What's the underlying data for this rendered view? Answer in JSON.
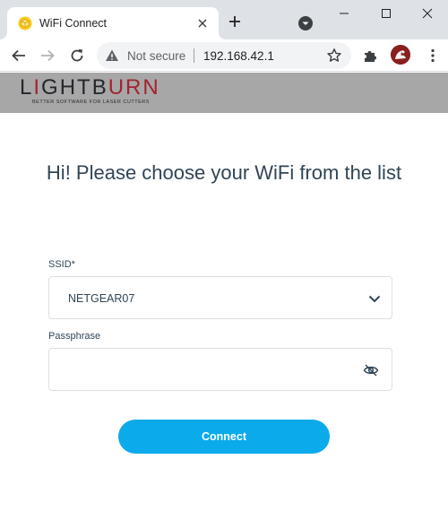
{
  "browser": {
    "tab": {
      "title": "WiFi Connect",
      "favicon": "yellow-cube-icon"
    },
    "toolbar": {
      "security_label": "Not secure",
      "url": "192.168.42.1"
    }
  },
  "brand": {
    "logo_text": "LIGHTBURN",
    "tagline": "BETTER SOFTWARE FOR LASER CUTTERS",
    "banner_color": "#a7a7a7",
    "accent_red": "#a3232f"
  },
  "form": {
    "heading": "Hi! Please choose your WiFi from the list",
    "ssid_label": "SSID*",
    "ssid_selected": "NETGEAR07",
    "passphrase_label": "Passphrase",
    "passphrase_value": "",
    "connect_label": "Connect",
    "button_color": "#0baaeb",
    "text_color": "#304555"
  }
}
